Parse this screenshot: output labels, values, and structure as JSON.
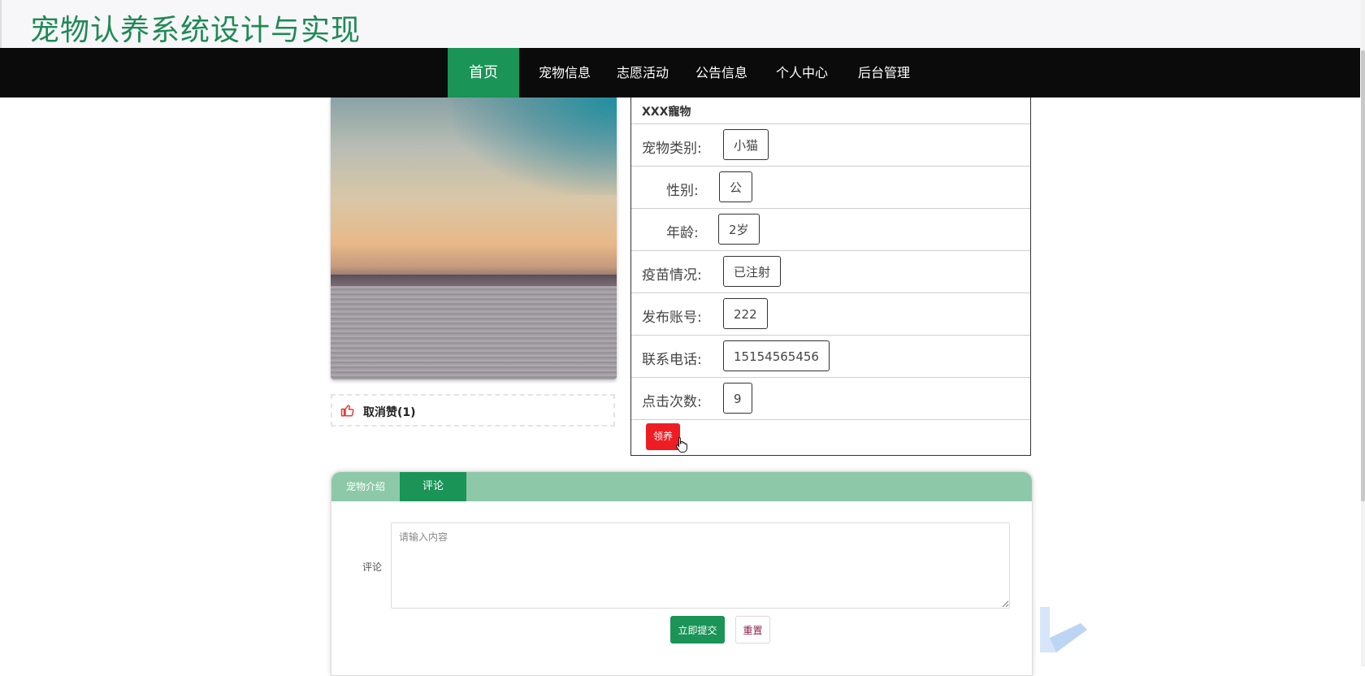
{
  "site": {
    "title": "宠物认养系统设计与实现"
  },
  "nav": {
    "items": [
      {
        "label": "首页",
        "active": true
      },
      {
        "label": "宠物信息"
      },
      {
        "label": "志愿活动"
      },
      {
        "label": "公告信息"
      },
      {
        "label": "个人中心"
      },
      {
        "label": "后台管理"
      }
    ]
  },
  "pet": {
    "name": "XXX寵物",
    "fields": [
      {
        "label": "宠物类别:",
        "value": "小猫"
      },
      {
        "label": "性别:",
        "value": "公"
      },
      {
        "label": "年龄:",
        "value": "2岁"
      },
      {
        "label": "疫苗情况:",
        "value": "已注射"
      },
      {
        "label": "发布账号:",
        "value": "222"
      },
      {
        "label": "联系电话:",
        "value": "15154565456"
      },
      {
        "label": "点击次数:",
        "value": "9"
      }
    ],
    "adopt_label": "领养",
    "like_label": "取消赞(1)"
  },
  "tabs": {
    "items": [
      {
        "label": "宠物介绍"
      },
      {
        "label": "评论",
        "active": true
      }
    ]
  },
  "comment": {
    "label": "评论",
    "placeholder": "请输入内容",
    "value": "",
    "submit_label": "立即提交",
    "reset_label": "重置"
  },
  "colors": {
    "brand": "#1e8a55",
    "nav_bg": "#0b0b0b",
    "nav_active": "#1a9457",
    "tab_bar": "#8dc9a8",
    "adopt": "#ee1d24",
    "like_icon": "#e33b3b"
  }
}
